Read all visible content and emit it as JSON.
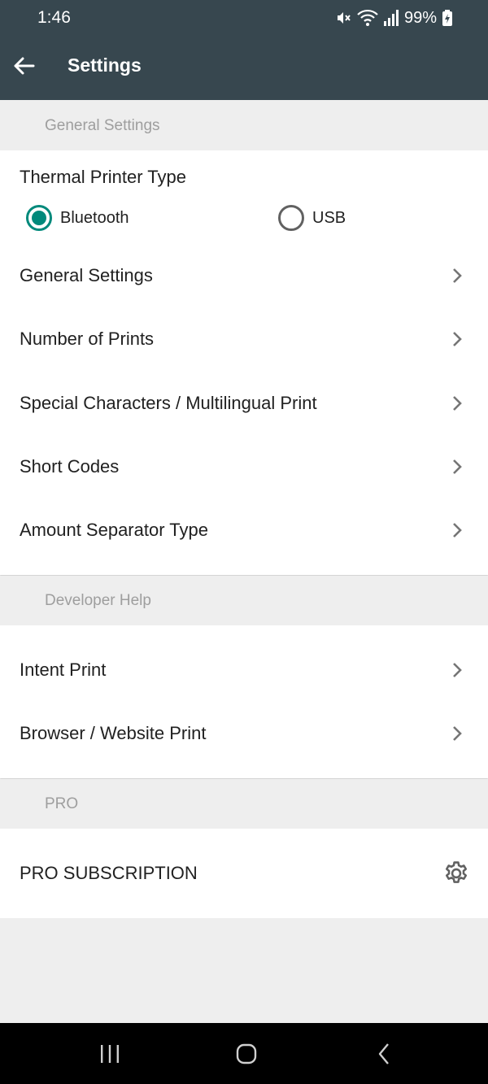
{
  "status_bar": {
    "time": "1:46",
    "battery": "99%",
    "icons": [
      "mute-icon",
      "wifi-icon",
      "signal-icon",
      "battery-charging-icon"
    ]
  },
  "toolbar": {
    "title": "Settings",
    "back_icon": "arrow-back-icon",
    "background": "#37474f"
  },
  "sections": {
    "general": {
      "header": "General Settings",
      "printer_type": {
        "label": "Thermal Printer Type",
        "options": [
          "Bluetooth",
          "USB"
        ],
        "selected": "Bluetooth"
      },
      "items": [
        "General Settings",
        "Number of Prints",
        "Special Characters / Multilingual Print",
        "Short Codes",
        "Amount Separator Type"
      ]
    },
    "developer": {
      "header": "Developer Help",
      "items": [
        "Intent Print",
        "Browser / Website Print"
      ]
    },
    "pro": {
      "header": "PRO",
      "items": [
        "PRO SUBSCRIPTION"
      ],
      "item_icon": "gear-icon"
    }
  },
  "colors": {
    "accent": "#00897b",
    "section_bg": "#eeeeee",
    "section_text": "#9e9e9e"
  },
  "nav_bar": {
    "buttons": [
      "recent-apps-icon",
      "home-icon",
      "back-icon"
    ]
  }
}
